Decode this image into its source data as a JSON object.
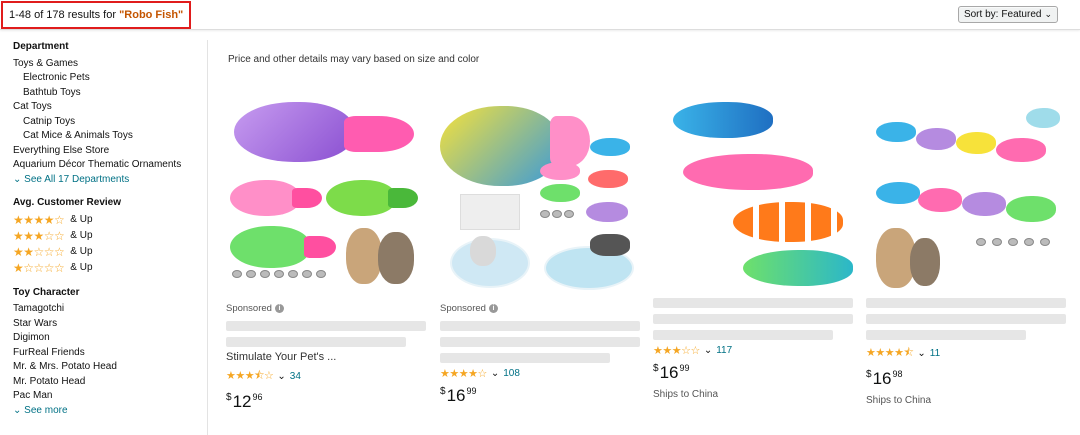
{
  "header": {
    "results_prefix": "1-48 of 178 results for ",
    "query": "\"Robo Fish\"",
    "sort_label": "Sort by:",
    "sort_value": "Featured"
  },
  "sidebar": {
    "department_heading": "Department",
    "departments": [
      {
        "label": "Toys & Games",
        "level": 0
      },
      {
        "label": "Electronic Pets",
        "level": 1
      },
      {
        "label": "Bathtub Toys",
        "level": 1
      },
      {
        "label": "Cat Toys",
        "level": 0
      },
      {
        "label": "Catnip Toys",
        "level": 1
      },
      {
        "label": "Cat Mice & Animals Toys",
        "level": 1
      },
      {
        "label": "Everything Else Store",
        "level": 0
      },
      {
        "label": "Aquarium Décor Thematic Ornaments",
        "level": 0
      }
    ],
    "see_all": "See All 17 Departments",
    "review_heading": "Avg. Customer Review",
    "review_rows": [
      {
        "stars": 4,
        "label": "& Up"
      },
      {
        "stars": 3,
        "label": "& Up"
      },
      {
        "stars": 2,
        "label": "& Up"
      },
      {
        "stars": 1,
        "label": "& Up"
      }
    ],
    "character_heading": "Toy Character",
    "characters": [
      "Tamagotchi",
      "Star Wars",
      "Digimon",
      "FurReal Friends",
      "Mr. & Mrs. Potato Head",
      "Mr. Potato Head",
      "Pac Man"
    ],
    "see_more": "See more"
  },
  "main": {
    "note": "Price and other details may vary based on size and color",
    "products": [
      {
        "sponsored": "Sponsored",
        "title": "Stimulate Your Pet's ...",
        "rating": 3.5,
        "reviews": "34",
        "price_whole": "12",
        "price_frac": "96",
        "ships": ""
      },
      {
        "sponsored": "Sponsored",
        "title": "",
        "rating": 4,
        "reviews": "108",
        "price_whole": "16",
        "price_frac": "99",
        "ships": ""
      },
      {
        "sponsored": "",
        "title": "",
        "rating": 3,
        "reviews": "117",
        "price_whole": "16",
        "price_frac": "99",
        "ships": "Ships to China"
      },
      {
        "sponsored": "",
        "title": "",
        "rating": 4.5,
        "reviews": "11",
        "price_whole": "16",
        "price_frac": "98",
        "ships": "Ships to China"
      }
    ]
  },
  "colors": {
    "link": "#007185",
    "star": "#f5a623",
    "query": "#c45500",
    "highlight_box": "#e01c1c"
  }
}
